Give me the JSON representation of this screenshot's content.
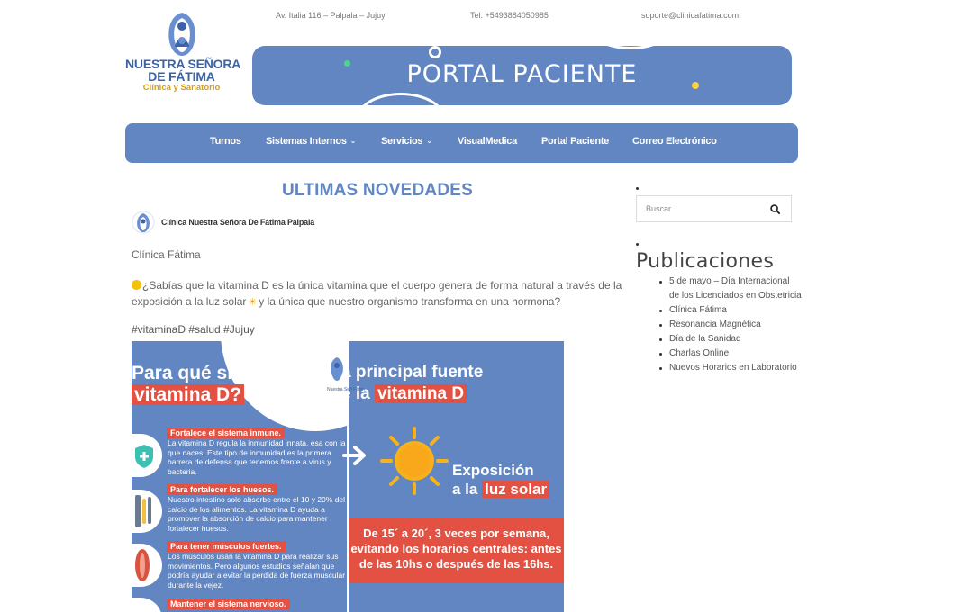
{
  "site": {
    "logo_name_line1": "NUESTRA SEÑORA",
    "logo_name_line2": "DE FÁTIMA",
    "logo_subtitle": "Clínica y Sanatorio"
  },
  "contact": {
    "address": "Av. Italia 116 – Palpala – Jujuy",
    "phone": "Tel: +5493884050985",
    "email": "soporte@clinicafatima.com"
  },
  "banner": {
    "title": "PORTAL PACIENTE"
  },
  "nav": {
    "items": [
      {
        "label": "Turnos",
        "has_dropdown": false
      },
      {
        "label": "Sistemas Internos",
        "has_dropdown": true
      },
      {
        "label": "Servicios",
        "has_dropdown": true
      },
      {
        "label": "VisualMedica",
        "has_dropdown": false
      },
      {
        "label": "Portal Paciente",
        "has_dropdown": false
      },
      {
        "label": "Correo Electrónico",
        "has_dropdown": false
      }
    ]
  },
  "main": {
    "section_title": "ULTIMAS NOVEDADES",
    "post": {
      "page_name": "Clínica Nuestra Señora De Fátima Palpalá",
      "author": "Clínica Fátima",
      "text": "¿Sabías que la vitamina D es la única vitamina que el cuerpo genera de forma natural a través de la exposición a la luz solar",
      "text_end": "y la única que nuestro organismo transforma en una hormona?",
      "hashtags": "#vitaminaD #salud #Jujuy",
      "image_left": {
        "title_line1": "Para qué sirve",
        "title_line2": "vitamina D?",
        "benefits": [
          {
            "title": "Fortalece el sistema inmune.",
            "body": "La vitamina D regula la inmunidad innata, esa con la que naces. Este tipo de inmunidad es la primera barrera de defensa que tenemos frente a virus y bacteria."
          },
          {
            "title": "Para fortalecer los huesos.",
            "body": "Nuestro intestino solo absorbe entre el 10 y 20% del calcio de los alimentos. La vitamina D ayuda a promover la absorción de calcio para mantener fortalecer huesos."
          },
          {
            "title": "Para tener músculos fuertes.",
            "body": "Los músculos usan la vitamina D para realizar sus movimientos. Pero algunos estudios señalan que podría ayudar a evitar la pérdida de fuerza muscular durante la vejez."
          },
          {
            "title": "Mantener el sistema nervioso.",
            "body": ""
          }
        ],
        "mini_logo_text": "Nuestra Señ Fátim"
      },
      "image_right": {
        "title_line1": "a principal fuente",
        "title_line2_pre": "e la",
        "title_line2_hl": "vitamina D",
        "expo_line1": "Exposición",
        "expo_line2_pre": "a la",
        "expo_line2_hl": "luz solar",
        "freq_line1": "De 15´ a 20´, 3 veces por semana,",
        "freq_line2_pre": "evitando los horarios centrales:",
        "freq_line2_post": "antes",
        "freq_line3": "de las 10hs o después de las 16hs."
      }
    }
  },
  "sidebar": {
    "search_placeholder": "Buscar",
    "publications_title": "Publicaciones",
    "publications": [
      "5 de mayo – Día Internacional de los Licenciados en Obstetricia",
      "Clínica Fátima",
      "Resonancia Magnética",
      "Día de la Sanidad",
      "Charlas Online",
      "Nuevos Horarios en Laboratorio"
    ]
  },
  "colors": {
    "brand_blue": "#6286c1",
    "accent_red": "#e25141",
    "logo_gold": "#d4a017",
    "sun_yellow": "#f5b21b"
  },
  "icons": [
    "logo-icon",
    "search-icon",
    "chevron-down-icon",
    "sun-icon",
    "arrow-right-icon",
    "shield-icon",
    "bone-icon",
    "muscle-icon"
  ]
}
